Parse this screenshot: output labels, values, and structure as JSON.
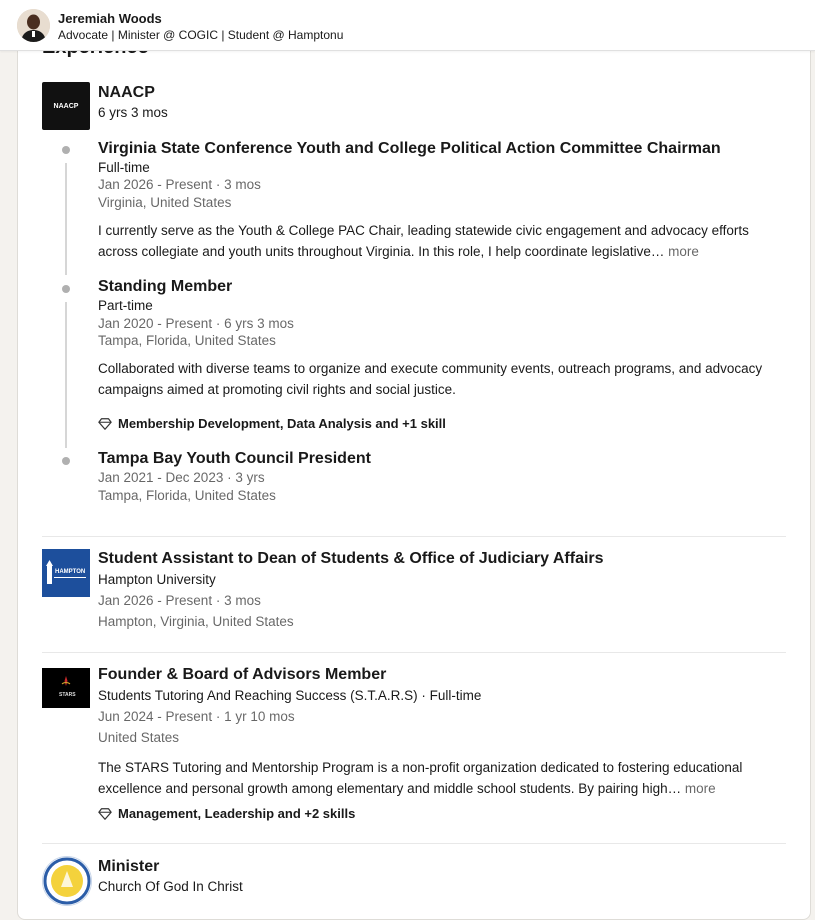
{
  "sticky": {
    "name": "Jeremiah Woods",
    "headline": "Advocate | Minister @ COGIC | Student @ Hamptonu"
  },
  "section_title": "Experience",
  "naacp": {
    "logo_text": "NAACP",
    "company": "NAACP",
    "duration": "6 yrs 3 mos",
    "roles": [
      {
        "title": "Virginia State Conference Youth and College Political Action Committee Chairman",
        "type": "Full-time",
        "dates": "Jan 2026 - Present · 3 mos",
        "location": "Virginia, United States",
        "desc_line1": "I currently serve as the Youth & College PAC Chair, leading statewide civic engagement and advocacy efforts",
        "desc_line2": "across collegiate and youth units throughout Virginia. In this role, I help coordinate legislative…",
        "more": "more"
      },
      {
        "title": "Standing Member",
        "type": "Part-time",
        "dates": "Jan 2020 - Present · 6 yrs 3 mos",
        "location": "Tampa, Florida, United States",
        "desc_line1": "Collaborated with diverse teams to organize and execute community events, outreach programs, and advocacy",
        "desc_line2": "campaigns aimed at promoting civil rights and social justice.",
        "skills": "Membership Development, Data Analysis and +1 skill"
      },
      {
        "title": "Tampa Bay Youth Council President",
        "dates": "Jan 2021 - Dec 2023 · 3 yrs",
        "location": "Tampa, Florida, United States"
      }
    ]
  },
  "hampton": {
    "logo_text": "HAMPTON",
    "title": "Student Assistant to Dean of Students & Office of Judiciary Affairs",
    "company": "Hampton University",
    "dates": "Jan 2026 - Present · 3 mos",
    "location": "Hampton, Virginia, United States"
  },
  "stars": {
    "logo_text": "STARS",
    "title": "Founder & Board of Advisors Member",
    "company": "Students Tutoring And Reaching Success (S.T.A.R.S) · Full-time",
    "dates": "Jun 2024 - Present · 1 yr 10 mos",
    "location": "United States",
    "desc_line1": "The STARS Tutoring and Mentorship Program is a non-profit organization dedicated to fostering educational",
    "desc_line2": "excellence and personal growth among elementary and middle school students. By pairing high…",
    "more": "more",
    "skills": "Management, Leadership and +2 skills"
  },
  "cogic": {
    "title": "Minister",
    "company": "Church Of God In Christ"
  },
  "icons": {
    "skills": "diamond-skills-icon",
    "logo_colors": {
      "naacp": "#111111",
      "hampton": "#1d4f9c",
      "stars": "#000000",
      "cogic": "#2b5da8"
    }
  }
}
